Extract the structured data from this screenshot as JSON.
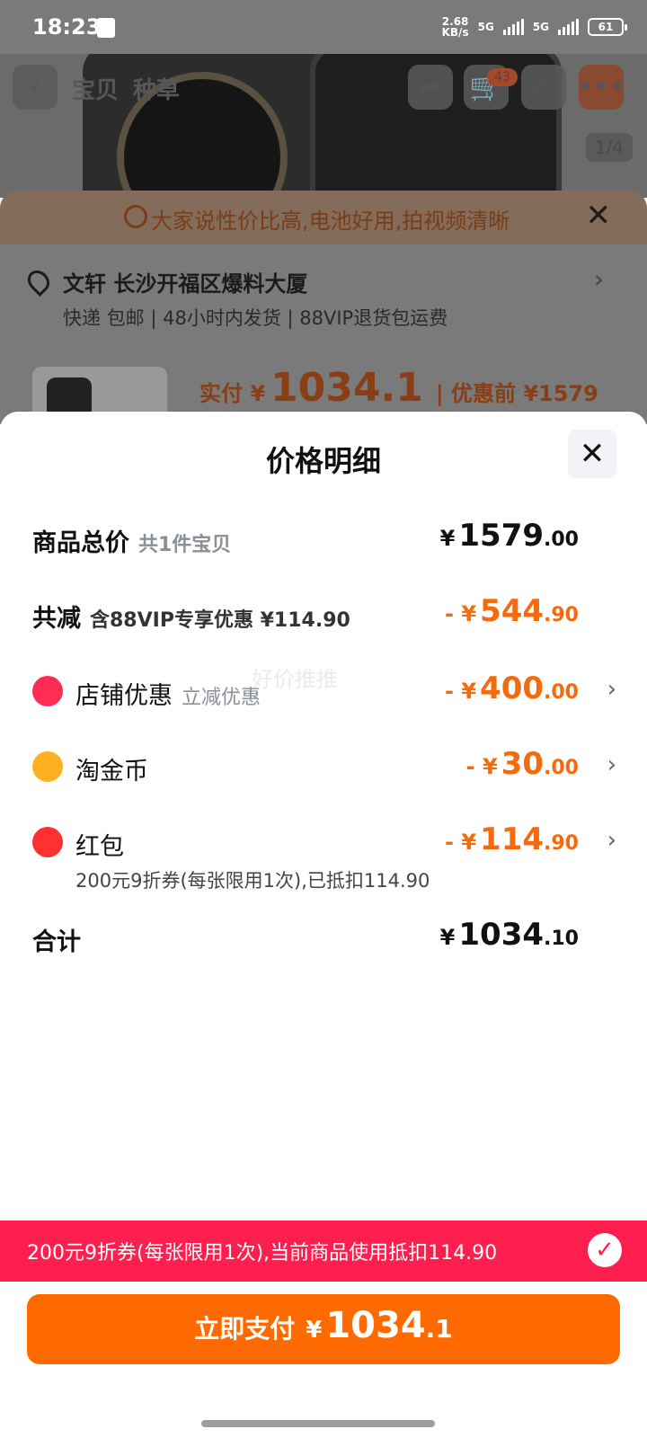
{
  "status_bar": {
    "time": "18:23",
    "net_speed_value": "2.68",
    "net_speed_unit": "KB/s",
    "sig1_label": "5G",
    "sig2_label": "5G",
    "battery": "61"
  },
  "background": {
    "tabs": [
      "宝贝",
      "种草"
    ],
    "cart_badge": "43",
    "page_indicator": "1/4",
    "tip_text": "大家说性价比高,电池好用,拍视频清晰",
    "address": "文轩 长沙开福区爆料大厦",
    "delivery_info": "快递 包邮 | 48小时内发货 | 88VIP退货包运费",
    "paid_label": "实付 ¥",
    "paid_amount": "1034.1",
    "original_price_label": "| 优惠前 ¥1579"
  },
  "sheet": {
    "title": "价格明细",
    "watermark": "好价推推",
    "rows": {
      "total": {
        "label": "商品总价",
        "sub": "共1件宝贝",
        "currency": "¥",
        "int": "1579",
        "dec": ".00"
      },
      "reduce": {
        "label": "共减",
        "sub": "含88VIP专享优惠 ¥114.90",
        "currency": "- ¥",
        "int": "544",
        "dec": ".90"
      },
      "shop": {
        "label": "店铺优惠",
        "sub": "立减优惠",
        "currency": "- ¥",
        "int": "400",
        "dec": ".00"
      },
      "coin": {
        "label": "淘金币",
        "currency": "- ¥",
        "int": "30",
        "dec": ".00"
      },
      "redpacket": {
        "label": "红包",
        "note": "200元9折券(每张限用1次),已抵扣114.90",
        "currency": "- ¥",
        "int": "114",
        "dec": ".90"
      },
      "sum": {
        "label": "合计",
        "currency": "¥",
        "int": "1034",
        "dec": ".10"
      }
    },
    "promo_text": "200元9折券(每张限用1次),当前商品使用抵扣114.90",
    "pay_button": {
      "label": "立即支付",
      "currency": "¥",
      "int": "1034",
      "dec": ".1"
    }
  },
  "colors": {
    "accent_orange": "#f46a0c",
    "pay_button": "#ff6a00",
    "promo_banner": "#ff1f4f",
    "shop_icon": "#ff2d55",
    "coin_icon": "#ffb020",
    "redpacket_icon": "#ff3030"
  },
  "icons": {
    "back": "chevron-left-icon",
    "share": "share-icon",
    "cart": "cart-icon",
    "favorite": "star-icon",
    "message": "message-icon",
    "tip": "chat-bubble-icon",
    "location": "location-pin-icon",
    "shop": "shop-icon",
    "coin": "coin-icon",
    "redpacket": "red-packet-icon",
    "check": "check-icon"
  }
}
